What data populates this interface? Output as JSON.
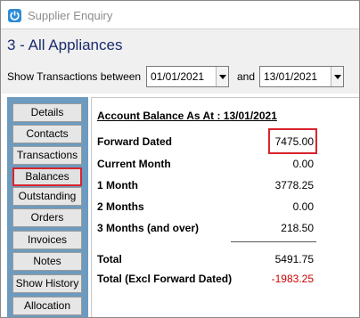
{
  "window": {
    "title": "Supplier Enquiry",
    "icon": "power-icon"
  },
  "header": {
    "page_title": "3 - All Appliances",
    "range_label": "Show Transactions between",
    "date_from": "01/01/2021",
    "and_label": "and",
    "date_to": "13/01/2021"
  },
  "nav": {
    "items": [
      {
        "label": "Details"
      },
      {
        "label": "Contacts"
      },
      {
        "label": "Transactions"
      },
      {
        "label": "Balances",
        "selected": true
      },
      {
        "label": "Outstanding"
      },
      {
        "label": "Orders"
      },
      {
        "label": "Invoices"
      },
      {
        "label": "Notes"
      },
      {
        "label": "Show History"
      },
      {
        "label": "Allocation"
      }
    ]
  },
  "balances": {
    "heading": "Account Balance As At : 13/01/2021",
    "rows": [
      {
        "label": "Forward Dated",
        "value": "7475.00"
      },
      {
        "label": "Current Month",
        "value": "0.00"
      },
      {
        "label": "1 Month",
        "value": "3778.25"
      },
      {
        "label": "2 Months",
        "value": "0.00"
      },
      {
        "label": "3 Months (and over)",
        "value": "218.50"
      }
    ],
    "total_label": "Total",
    "total_value": "5491.75",
    "total_excl_label": "Total (Excl Forward Dated)",
    "total_excl_value": "-1983.25"
  },
  "colors": {
    "accent_red": "#d9232c",
    "negative": "#cc0000",
    "nav_bg": "#6d9bbf",
    "title": "#1a2c6e"
  }
}
